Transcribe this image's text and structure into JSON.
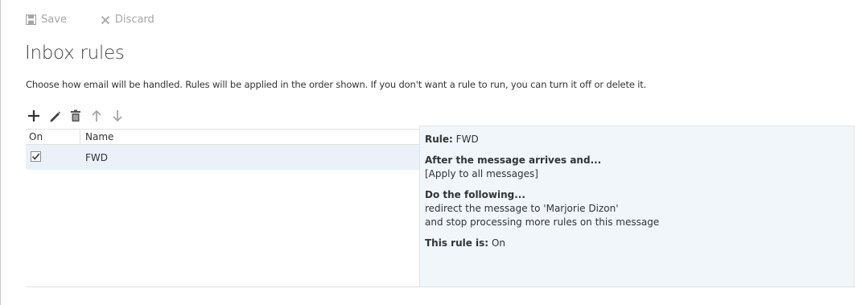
{
  "commands": {
    "save_label": "Save",
    "discard_label": "Discard"
  },
  "page": {
    "title": "Inbox rules",
    "description": "Choose how email will be handled. Rules will be applied in the order shown. If you don't want a rule to run, you can turn it off or delete it."
  },
  "toolbar": [
    "add-icon",
    "edit-icon",
    "delete-icon",
    "move-up-icon",
    "move-down-icon"
  ],
  "list": {
    "columns": {
      "on": "On",
      "name": "Name"
    },
    "rows": [
      {
        "on": true,
        "name": "FWD"
      }
    ]
  },
  "detail": {
    "rule_label": "Rule:",
    "rule_name": "FWD",
    "condition_heading": "After the message arrives and...",
    "condition_text": "[Apply to all messages]",
    "action_heading": "Do the following...",
    "action_line1": "redirect the message to 'Marjorie Dizon'",
    "action_line2": "and stop processing more rules on this message",
    "status_label": "This rule is:",
    "status_value": "On"
  },
  "colors": {
    "accent_bg": "#f1f6fb",
    "row_selected": "#eaf1f8",
    "disabled_text": "#a6a6a6"
  }
}
